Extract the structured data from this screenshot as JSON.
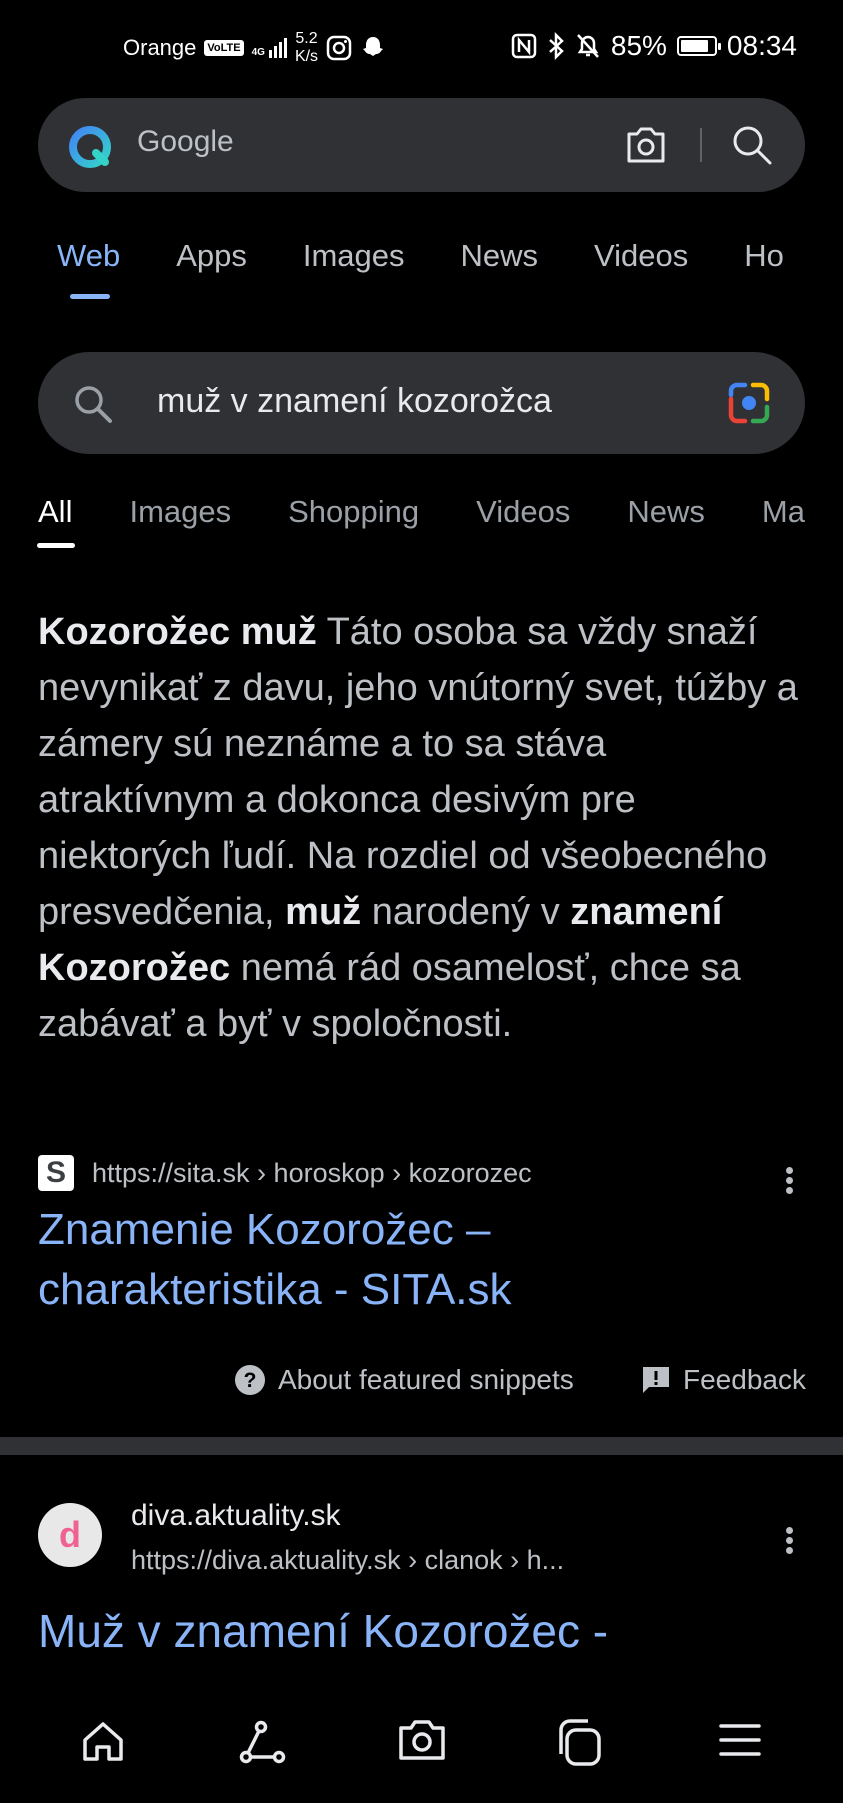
{
  "status_bar": {
    "carrier": "Orange",
    "volte": "VoLTE",
    "net": "4G",
    "speed_value": "5.2",
    "speed_unit": "K/s",
    "battery": "85%",
    "battery_level": 0.85,
    "time": "08:34"
  },
  "top_bar": {
    "engine_label": "Google"
  },
  "tabs_primary": [
    "Web",
    "Apps",
    "Images",
    "News",
    "Videos",
    "Ho"
  ],
  "query": {
    "text": "muž v znamení kozorožca"
  },
  "tabs_secondary": [
    "All",
    "Images",
    "Shopping",
    "Videos",
    "News",
    "Ma"
  ],
  "featured_snippet": {
    "parts": [
      {
        "t": "Kozorožec muž",
        "b": true
      },
      {
        "t": " Táto osoba sa vždy snaží nevynikať z davu, jeho vnútorný svet, túžby a zámery sú neznáme a to sa stáva atraktívnym a dokonca desivým pre niektorých ľudí. Na rozdiel od všeobecného presvedčenia, ",
        "b": false
      },
      {
        "t": "muž",
        "b": true
      },
      {
        "t": " narodený v ",
        "b": false
      },
      {
        "t": "znamení Kozorožec",
        "b": true
      },
      {
        "t": " nemá rád osamelosť, chce sa zabávať a byť v spoločnosti.",
        "b": false
      }
    ],
    "source_favicon": "S",
    "source_url": "https://sita.sk › horoskop › kozorozec",
    "title": "Znamenie Kozorožec – charakteristika - SITA.sk",
    "about_label": "About featured snippets",
    "feedback_label": "Feedback"
  },
  "result2": {
    "favicon": "d",
    "site": "diva.aktuality.sk",
    "url": "https://diva.aktuality.sk › clanok › h...",
    "title": "Muž v znamení Kozorožec -"
  },
  "colors": {
    "background": "#000000",
    "surface": "#303134",
    "link": "#8ab4f8",
    "text": "#e8eaed",
    "muted": "#bdc1c6"
  }
}
